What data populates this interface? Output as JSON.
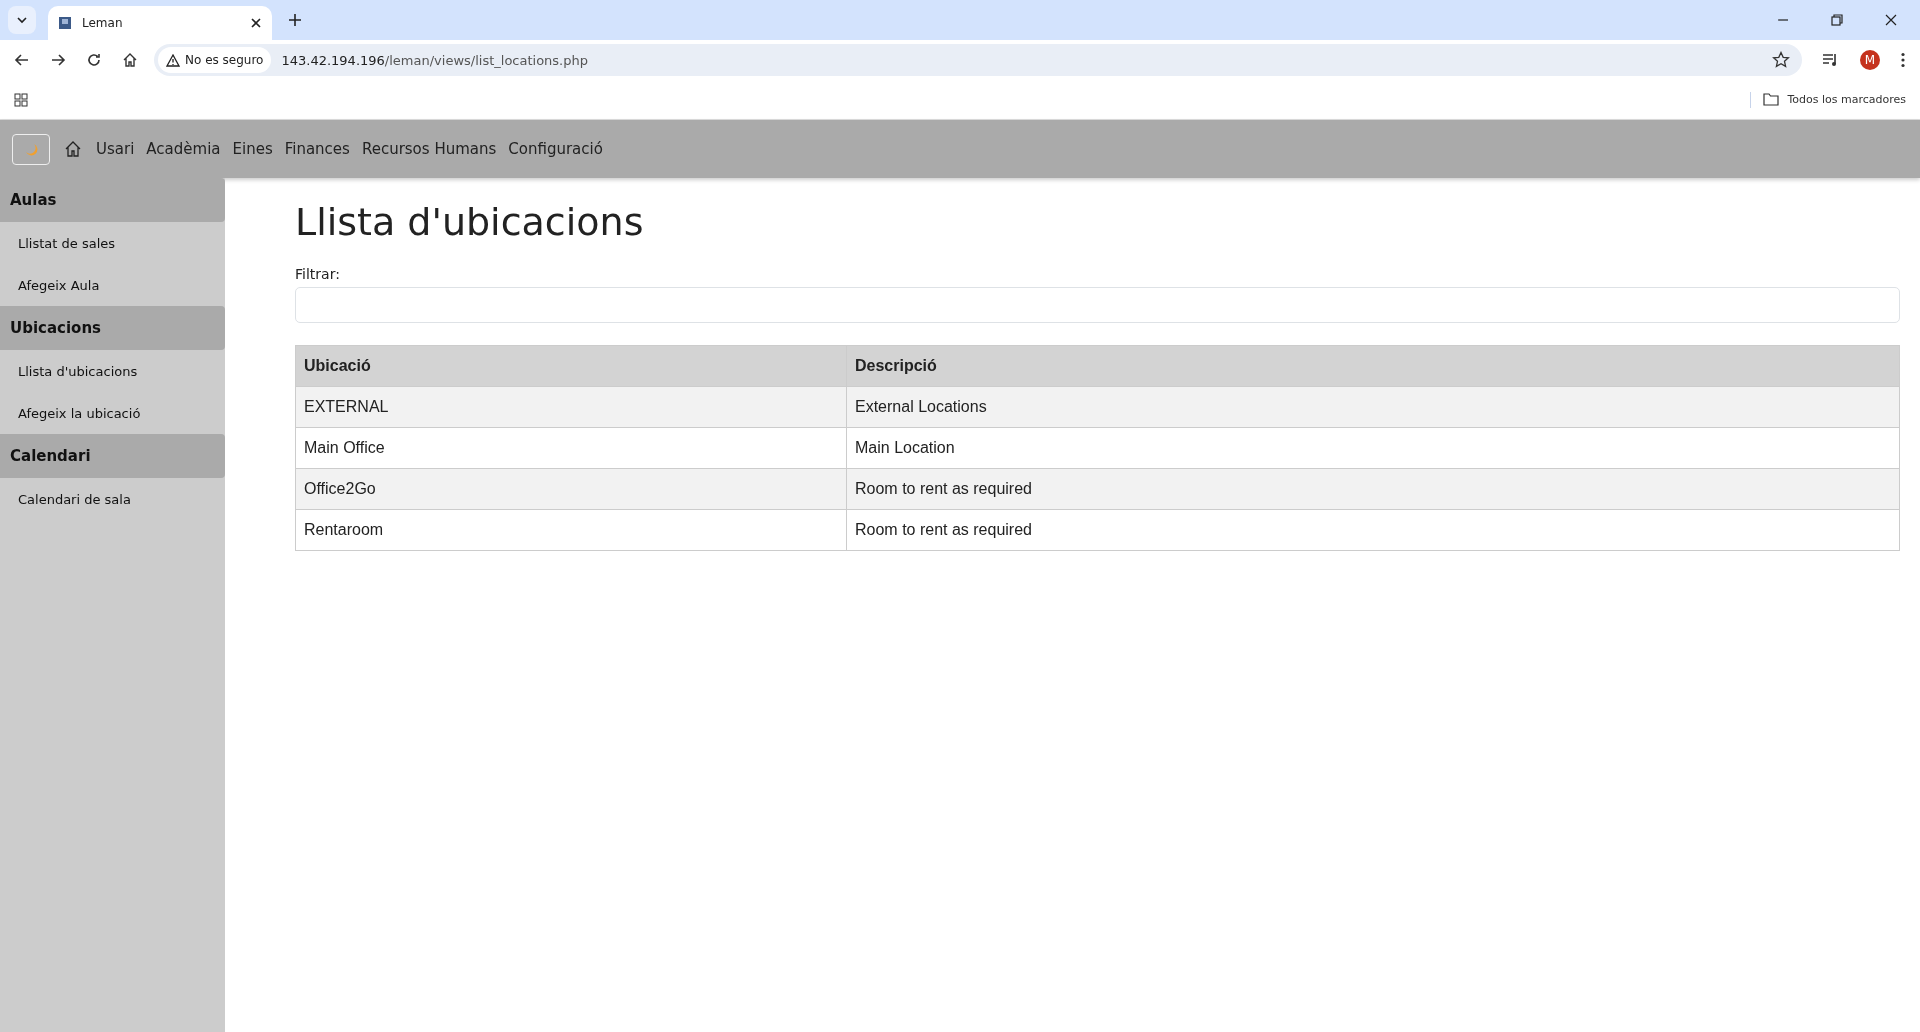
{
  "browser": {
    "tab_title": "Leman",
    "security_label": "No es seguro",
    "url_host": "143.42.194.196",
    "url_path": "/leman/views/list_locations.php",
    "avatar_letter": "M",
    "bookmarks_label": "Todos los marcadores"
  },
  "navbar": {
    "items": [
      "Usari",
      "Acadèmia",
      "Eines",
      "Finances",
      "Recursos Humans",
      "Configuració"
    ]
  },
  "sidebar": {
    "sections": [
      {
        "title": "Aulas",
        "items": [
          "Llistat de sales",
          "Afegeix Aula"
        ]
      },
      {
        "title": "Ubicacions",
        "items": [
          "Llista d'ubicacions",
          "Afegeix la ubicació"
        ]
      },
      {
        "title": "Calendari",
        "items": [
          "Calendari de sala"
        ]
      }
    ]
  },
  "page": {
    "title": "Llista d'ubicacions",
    "filter_label": "Filtrar:"
  },
  "table": {
    "columns": [
      "Ubicació",
      "Descripció"
    ],
    "rows": [
      [
        "EXTERNAL",
        "External Locations"
      ],
      [
        "Main Office",
        "Main Location"
      ],
      [
        "Office2Go",
        "Room to rent as required"
      ],
      [
        "Rentaroom",
        "Room to rent as required"
      ]
    ]
  }
}
